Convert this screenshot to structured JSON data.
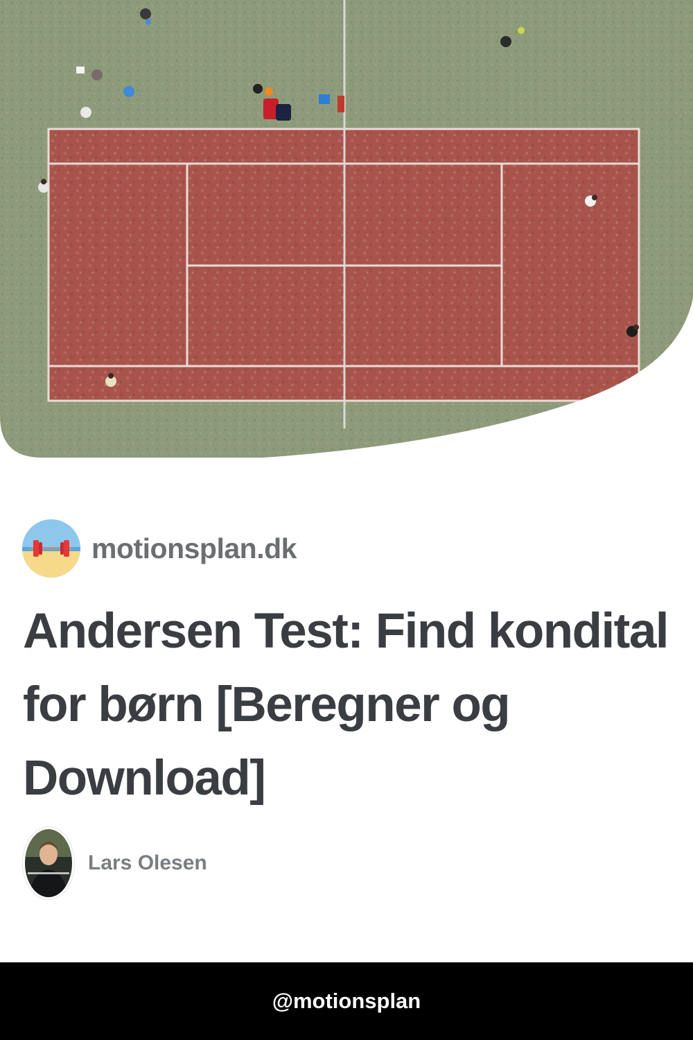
{
  "hero": {
    "image": "aerial-tennis-court-photo"
  },
  "site": {
    "name": "motionsplan.dk",
    "logo_icon": "barbell-on-beach-icon"
  },
  "article": {
    "title": "Andersen Test: Find kondital for børn [Beregner og Download]"
  },
  "author": {
    "name": "Lars Olesen",
    "avatar": "author-photo"
  },
  "footer": {
    "handle": "@motionsplan"
  },
  "colors": {
    "court": "#a6504a",
    "grass": "#8c9a78",
    "text": "#3a3d42",
    "muted": "#6b6e72"
  }
}
